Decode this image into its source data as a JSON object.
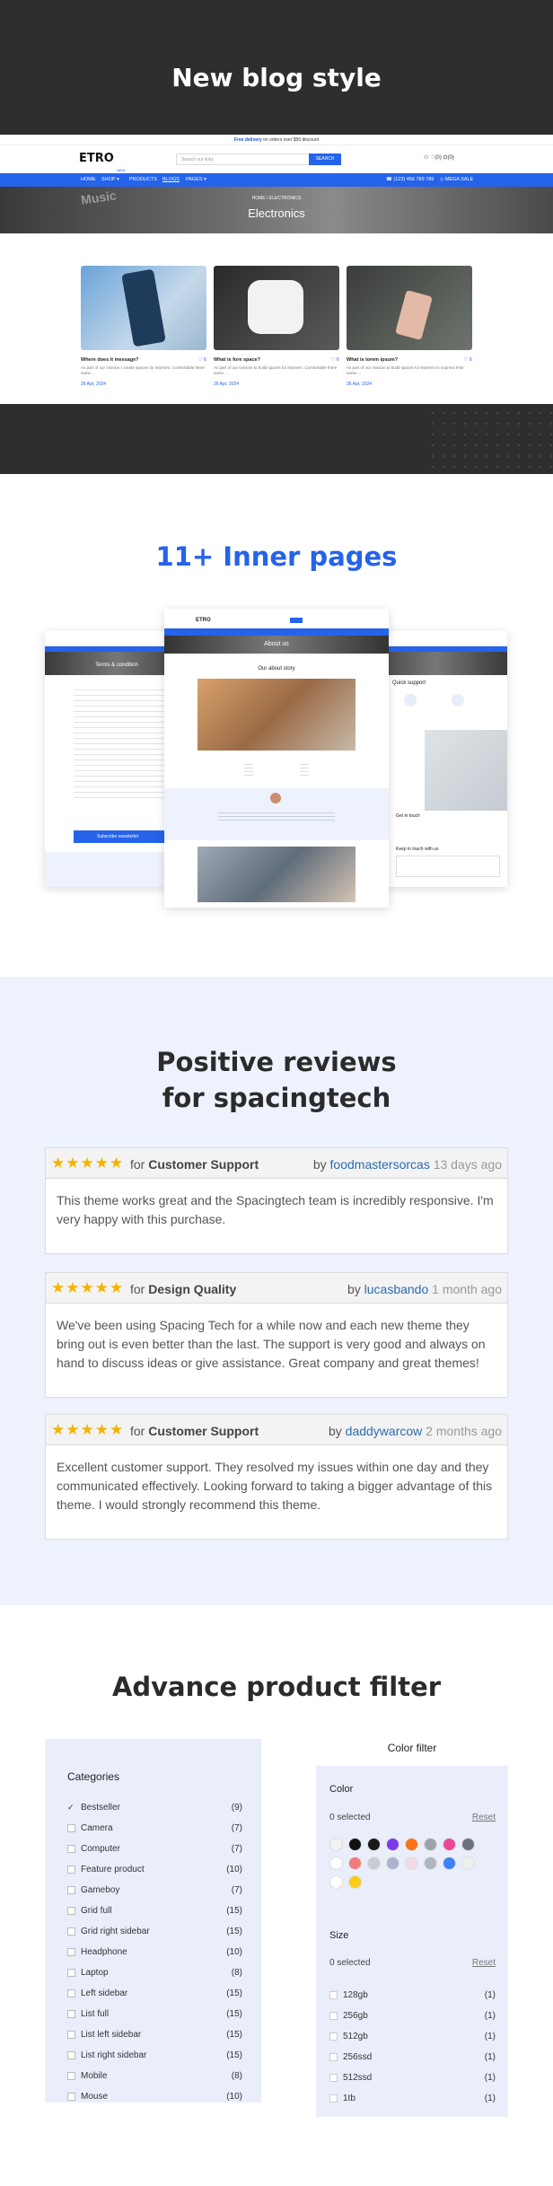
{
  "blog": {
    "title": "New blog style",
    "topbar_bold": "Free delivery",
    "topbar_rest": " on orders over $50 discount",
    "logo": "ETRO",
    "search_placeholder": "Search our links",
    "search_button": "SEARCH",
    "header_icons": "♡(0)  ⊡(0)",
    "nav": [
      "HOME",
      "SHOP ▾",
      "PRODUCTS",
      "BLOGS",
      "PAGES ▾"
    ],
    "nav_badge": "NEW",
    "phone": "☎ (123) 456 789 789",
    "mega_sale": "◇ MEGA SALE",
    "hero_crumb": "HOME / ELECTRONICS",
    "hero_title": "Electronics",
    "hero_bg_word": "Music",
    "cards": [
      {
        "title": "Where does it message?",
        "hearts": "♡ 6",
        "desc": "As part of our mission I create spaces for learners. Comfortable there same ...",
        "date": "26 Apr, 2024"
      },
      {
        "title": "What is fore space?",
        "hearts": "♡ 6",
        "desc": "As part of our mission to build spaces for learners. Comfortable there same ...",
        "date": "26 Apr, 2024"
      },
      {
        "title": "What is lorem ipsum?",
        "hearts": "♡ 6",
        "desc": "As part of our mission to build spaces for learners to express their same ...",
        "date": "26 Apr, 2024"
      }
    ]
  },
  "inner": {
    "title_accent": "11+",
    "title_rest": " Inner pages",
    "about_hero": "About us",
    "our_story": "Our about story",
    "quick_support": "Quick support",
    "get_in_touch": "Get in touch",
    "keep_touch": "Keep in touch with us",
    "subscribe": "Subscribe newsletter",
    "terms_hero": "Terms & condition"
  },
  "reviews": {
    "title_line1": "Positive reviews",
    "title_line2": "for spacingtech",
    "items": [
      {
        "stars": "★★★★★",
        "for": "for ",
        "category": "Customer Support",
        "by": "by ",
        "user": "foodmastersorcas",
        "when": " 13 days ago",
        "text": "This theme works great and the Spacingtech team is incredibly responsive. I'm very happy with this purchase."
      },
      {
        "stars": "★★★★★",
        "for": "for ",
        "category": "Design Quality",
        "by": "by ",
        "user": "lucasbando",
        "when": " 1 month ago",
        "text": "We've been using Spacing Tech for a while now and each new theme they bring out is even better than the last. The support is very good and always on hand to discuss ideas or give assistance. Great company and great themes!"
      },
      {
        "stars": "★★★★★",
        "for": "for ",
        "category": "Customer Support",
        "by": "by ",
        "user": "daddywarcow",
        "when": " 2 months ago",
        "text": "Excellent customer support. They resolved my issues within one day and they communicated effectively. Looking forward to taking a bigger advantage of this theme. I would strongly recommend this theme."
      }
    ]
  },
  "filter": {
    "title": "Advance product filter",
    "categories_title": "Categories",
    "categories": [
      {
        "label": "Bestseller",
        "count": "(9)",
        "checked": true
      },
      {
        "label": "Camera",
        "count": "(7)"
      },
      {
        "label": "Computer",
        "count": "(7)"
      },
      {
        "label": "Feature product",
        "count": "(10)"
      },
      {
        "label": "Gameboy",
        "count": "(7)"
      },
      {
        "label": "Grid full",
        "count": "(15)"
      },
      {
        "label": "Grid right sidebar",
        "count": "(15)"
      },
      {
        "label": "Headphone",
        "count": "(10)"
      },
      {
        "label": "Laptop",
        "count": "(8)"
      },
      {
        "label": "Left sidebar",
        "count": "(15)"
      },
      {
        "label": "List full",
        "count": "(15)"
      },
      {
        "label": "List left sidebar",
        "count": "(15)"
      },
      {
        "label": "List right sidebar",
        "count": "(15)"
      },
      {
        "label": "Mobile",
        "count": "(8)"
      },
      {
        "label": "Mouse",
        "count": "(10)"
      }
    ],
    "color_filter_title": "Color filter",
    "color_label": "Color",
    "color_selected": "0 selected",
    "reset": "Reset",
    "swatches": [
      "#f3f3f3",
      "#111111",
      "#1a1a1a",
      "#7c3aed",
      "#f97316",
      "#9ca3af",
      "#ec4899",
      "#6b7280",
      "#ffffff",
      "#ef7b7b",
      "#c9ccd3",
      "#a9b4d0",
      "#f3d9e3",
      "#b0b4bd",
      "#3b82f6",
      "#f0f0f0",
      "#ffffff",
      "#facc15"
    ],
    "size_label": "Size",
    "size_selected": "0 selected",
    "sizes": [
      {
        "label": "128gb",
        "count": "(1)"
      },
      {
        "label": "256gb",
        "count": "(1)"
      },
      {
        "label": "512gb",
        "count": "(1)"
      },
      {
        "label": "256ssd",
        "count": "(1)"
      },
      {
        "label": "512ssd",
        "count": "(1)"
      },
      {
        "label": "1tb",
        "count": "(1)"
      }
    ]
  }
}
